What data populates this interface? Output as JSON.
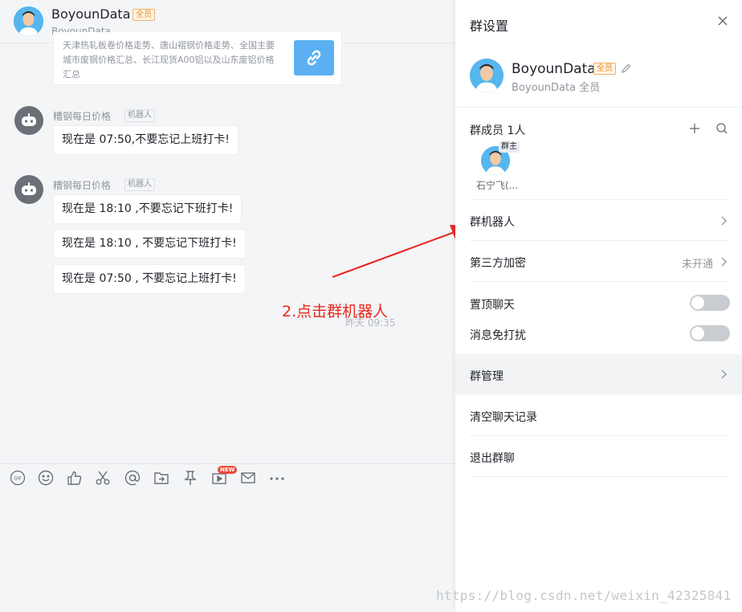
{
  "chat": {
    "title": "BoyounData",
    "badge": "全员",
    "subtitle": "BoyounData",
    "link_card_text": "天津热轧板卷价格走势、唐山褶钢价格走势、全国主要城市废钢价格汇总、长江现货A00铝以及山东废铝价格汇总",
    "messages": [
      {
        "sender": "糟钢每日价格",
        "tag": "机器人",
        "bubbles": [
          "现在是 07:50,不要忘记上班打卡!"
        ]
      },
      {
        "sender": "糟钢每日价格",
        "tag": "机器人",
        "bubbles": [
          "现在是 18:10 ,不要忘记下班打卡!",
          "现在是 18:10 , 不要忘记下班打卡!",
          "现在是 07:50 , 不要忘记上班打卡!"
        ]
      }
    ],
    "timestamp": "昨天 09:35",
    "annotation": "2.点击群机器人",
    "new_badge": "NEW"
  },
  "toolbar": {
    "icons": [
      "gif-icon",
      "emoji-icon",
      "thumbs-up-icon",
      "scissors-icon",
      "at-icon",
      "folder-icon",
      "pin-icon",
      "video-icon",
      "mail-icon",
      "more-icon"
    ],
    "gif_label": "GIF"
  },
  "panel": {
    "title": "群设置",
    "group_name": "BoyounData",
    "badge": "全员",
    "group_sub": "BoyounData 全员",
    "members_label": "群成员 1人",
    "owner_tag": "群主",
    "member_name": "石宁飞(...",
    "rows": {
      "bot": "群机器人",
      "encrypt": "第三方加密",
      "encrypt_value": "未开通",
      "pin": "置顶聊天",
      "mute": "消息免打扰",
      "manage": "群管理",
      "clear": "清空聊天记录",
      "leave": "退出群聊"
    },
    "toggles": {
      "pin": false,
      "mute": false
    }
  },
  "watermark": "https://blog.csdn.net/weixin_42325841",
  "colors": {
    "accent_red": "#e8281e",
    "badge_orange": "#f08a24",
    "link_blue": "#5ab0f2"
  }
}
